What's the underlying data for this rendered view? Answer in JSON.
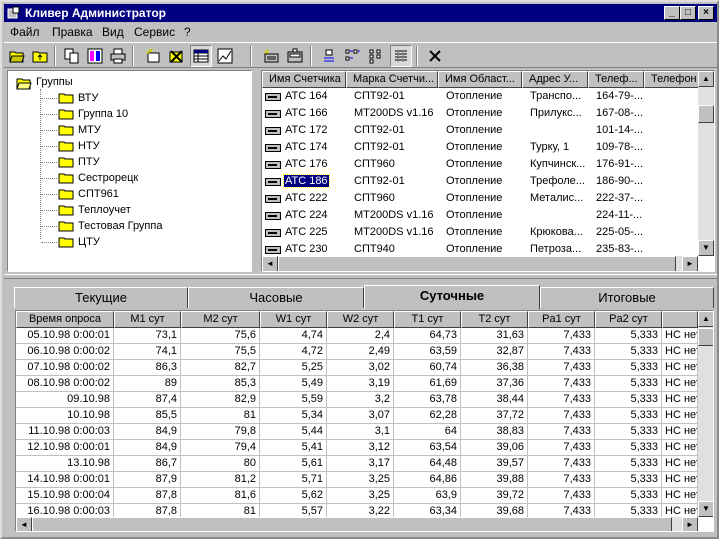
{
  "window": {
    "title": "Кливер Администратор"
  },
  "menu": [
    "Файл",
    "Правка",
    "Вид",
    "Сервис",
    "?"
  ],
  "toolbar": {
    "buttons": [
      "open-folder-icon",
      "up-folder-icon",
      "copy-icon",
      "colors-icon",
      "print-icon",
      "new-item-icon",
      "delete-item-icon",
      "grid-view-icon",
      "chart-icon",
      "new-meter-icon",
      "meter-properties-icon",
      "large-icons-icon",
      "small-icons-icon",
      "list-view-icon",
      "details-view-icon",
      "close-icon"
    ]
  },
  "tree": {
    "root": "Группы",
    "items": [
      "ВТУ",
      "Группа 10",
      "МТУ",
      "НТУ",
      "ПТУ",
      "Сестрорецк",
      "СПТ961",
      "Теплоучет",
      "Тестовая Группа",
      "ЦТУ"
    ]
  },
  "meters": {
    "columns": [
      "Имя Счетчика",
      "Марка Счетчи...",
      "Имя Област...",
      "Адрес У...",
      "Телеф...",
      "Телефон"
    ],
    "rows": [
      [
        "АТС 164",
        "СПТ92-01",
        "Отопление",
        "Транспо...",
        "164-79-...",
        ""
      ],
      [
        "АТС 166",
        "MT200DS v1.16",
        "Отопление",
        "Прилукс...",
        "167-08-...",
        ""
      ],
      [
        "АТС 172",
        "СПТ92-01",
        "Отопление",
        "",
        "101-14-...",
        ""
      ],
      [
        "АТС 174",
        "СПТ92-01",
        "Отопление",
        "Турку, 1",
        "109-78-...",
        ""
      ],
      [
        "АТС 176",
        "СПТ960",
        "Отопление",
        "Купчинск...",
        "176-91-...",
        ""
      ],
      [
        "АТС 186",
        "СПТ92-01",
        "Отопление",
        "Трефоле...",
        "186-90-...",
        ""
      ],
      [
        "АТС 222",
        "СПТ960",
        "Отопление",
        "Металис...",
        "222-37-...",
        ""
      ],
      [
        "АТС 224",
        "MT200DS v1.16",
        "Отопление",
        "",
        "224-11-...",
        ""
      ],
      [
        "АТС 225",
        "MT200DS v1.16",
        "Отопление",
        "Крюкова...",
        "225-05-...",
        ""
      ],
      [
        "АТС 230",
        "СПТ940",
        "Отопление",
        "Петроза...",
        "235-83-...",
        ""
      ]
    ],
    "selected_row": 5
  },
  "tabs": [
    "Текущие",
    "Часовые",
    "Суточные",
    "Итоговые"
  ],
  "active_tab": 2,
  "data": {
    "columns": [
      "Время опроса",
      "M1 сут",
      "M2 сут",
      "W1 сут",
      "W2 сут",
      "T1 сут",
      "T2 сут",
      "Pa1 сут",
      "Pa2 сут",
      ""
    ],
    "rows": [
      [
        "05.10.98 0:00:01",
        "73,1",
        "75,6",
        "4,74",
        "2,4",
        "64,73",
        "31,63",
        "7,433",
        "5,333",
        "НС нет"
      ],
      [
        "06.10.98 0:00:02",
        "74,1",
        "75,5",
        "4,72",
        "2,49",
        "63,59",
        "32,87",
        "7,433",
        "5,333",
        "НС нет"
      ],
      [
        "07.10.98 0:00:02",
        "86,3",
        "82,7",
        "5,25",
        "3,02",
        "60,74",
        "36,38",
        "7,433",
        "5,333",
        "НС нет"
      ],
      [
        "08.10.98 0:00:02",
        "89",
        "85,3",
        "5,49",
        "3,19",
        "61,69",
        "37,36",
        "7,433",
        "5,333",
        "НС нет"
      ],
      [
        "09.10.98",
        "87,4",
        "82,9",
        "5,59",
        "3,2",
        "63,78",
        "38,44",
        "7,433",
        "5,333",
        "НС нет"
      ],
      [
        "10.10.98",
        "85,5",
        "81",
        "5,34",
        "3,07",
        "62,28",
        "37,72",
        "7,433",
        "5,333",
        "НС нет"
      ],
      [
        "11.10.98 0:00:03",
        "84,9",
        "79,8",
        "5,44",
        "3,1",
        "64",
        "38,83",
        "7,433",
        "5,333",
        "НС нет"
      ],
      [
        "12.10.98 0:00:01",
        "84,9",
        "79,4",
        "5,41",
        "3,12",
        "63,54",
        "39,06",
        "7,433",
        "5,333",
        "НС нет"
      ],
      [
        "13.10.98",
        "86,7",
        "80",
        "5,61",
        "3,17",
        "64,48",
        "39,57",
        "7,433",
        "5,333",
        "НС нет"
      ],
      [
        "14.10.98 0:00:01",
        "87,9",
        "81,2",
        "5,71",
        "3,25",
        "64,86",
        "39,88",
        "7,433",
        "5,333",
        "НС нет"
      ],
      [
        "15.10.98 0:00:04",
        "87,8",
        "81,6",
        "5,62",
        "3,25",
        "63,9",
        "39,72",
        "7,433",
        "5,333",
        "НС нет"
      ],
      [
        "16.10.98 0:00:03",
        "87,8",
        "81",
        "5,57",
        "3,22",
        "63,34",
        "39,68",
        "7,433",
        "5,333",
        "НС нет"
      ]
    ]
  }
}
